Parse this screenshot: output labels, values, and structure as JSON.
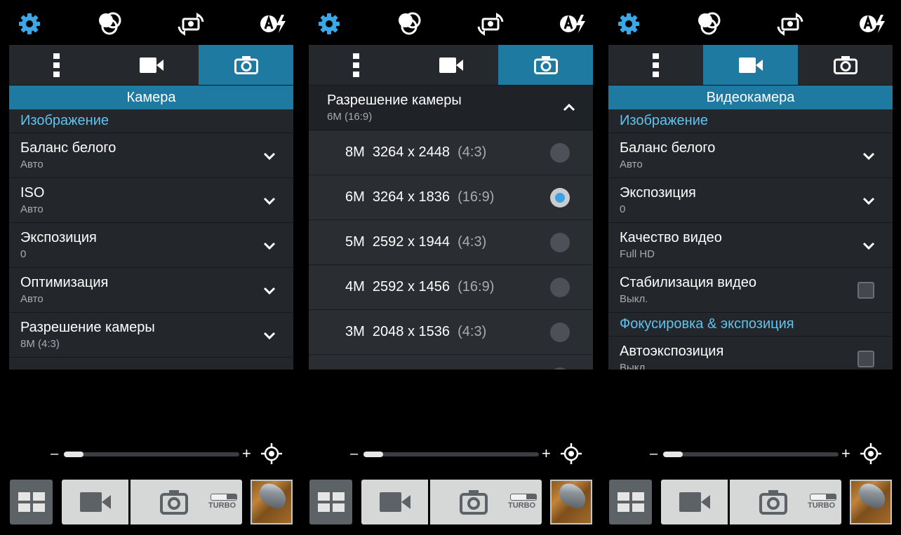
{
  "colors": {
    "accent": "#1e7aa1",
    "section_text": "#5ec4f0",
    "panel": "#23262b",
    "radio_selected": "#3aa3e0"
  },
  "topbar_icons": [
    "settings-icon",
    "color-effects-icon",
    "switch-camera-icon",
    "auto-flash-icon"
  ],
  "screen1": {
    "header": "Камера",
    "section": "Изображение",
    "rows": [
      {
        "title": "Баланс белого",
        "sub": "Авто"
      },
      {
        "title": "ISO",
        "sub": "Авто"
      },
      {
        "title": "Экспозиция",
        "sub": "0"
      },
      {
        "title": "Оптимизация",
        "sub": "Авто"
      },
      {
        "title": "Разрешение камеры",
        "sub": "8M (4:3)"
      }
    ]
  },
  "screen2": {
    "expanded_title": "Разрешение камеры",
    "expanded_sub": "6M (16:9)",
    "options": [
      {
        "text": "8M  3264 x 2448",
        "ratio": "(4:3)",
        "selected": false
      },
      {
        "text": "6M  3264 x 1836",
        "ratio": "(16:9)",
        "selected": true
      },
      {
        "text": "5M  2592 x 1944",
        "ratio": "(4:3)",
        "selected": false
      },
      {
        "text": "4M  2592 x 1456",
        "ratio": "(16:9)",
        "selected": false
      },
      {
        "text": "3M  2048 x 1536",
        "ratio": "(4:3)",
        "selected": false
      }
    ]
  },
  "screen3": {
    "header": "Видеокамера",
    "section": "Изображение",
    "rows": [
      {
        "title": "Баланс белого",
        "sub": "Авто"
      },
      {
        "title": "Экспозиция",
        "sub": "0"
      },
      {
        "title": "Качество видео",
        "sub": "Full HD"
      }
    ],
    "stabilization": {
      "title": "Стабилизация видео",
      "sub": "Выкл."
    },
    "section2": "Фокусировка & экспозиция",
    "autoexposure": {
      "title": "Автоэкспозиция",
      "sub": "Выкл."
    }
  },
  "zoom": {
    "minus": "–",
    "plus": "+",
    "level": 0.1
  },
  "turbo_label": "TURBO"
}
